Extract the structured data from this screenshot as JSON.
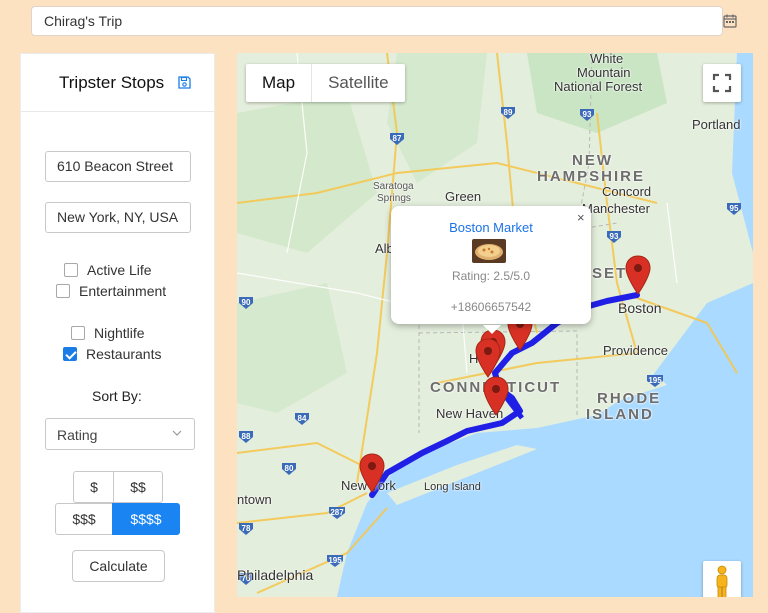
{
  "trip": {
    "name": "Chirag's Trip",
    "icon": "calendar-icon"
  },
  "sidebar": {
    "title": "Tripster Stops",
    "save_icon": "save-icon",
    "start_address": "610 Beacon Street",
    "end_address": "New York, NY, USA",
    "categories": [
      {
        "label": "Active Life",
        "checked": false
      },
      {
        "label": "Entertainment",
        "checked": false
      },
      {
        "label": "Nightlife",
        "checked": false
      },
      {
        "label": "Restaurants",
        "checked": true
      }
    ],
    "sort_label": "Sort By:",
    "sort_value": "Rating",
    "price_options": [
      "$",
      "$$",
      "$$$",
      "$$$$"
    ],
    "price_selected": "$$$$",
    "calculate_label": "Calculate"
  },
  "map": {
    "type_options": [
      "Map",
      "Satellite"
    ],
    "type_selected": "Map",
    "route_color": "#1f1fe6",
    "pin_color": "#d93025",
    "labels": {
      "white_mountain": "White",
      "white_mountain2": "Mountain",
      "white_mountain3": "National Forest",
      "portland": "Portland",
      "new": "NEW",
      "hampshire": "HAMPSHIRE",
      "concord": "Concord",
      "manchester": "Manchester",
      "saratoga": "Saratoga",
      "springs": "Springs",
      "green": "Green",
      "alb": "Alb",
      "boston": "Boston",
      "massachusetts": "SETTS",
      "providence": "Providence",
      "connecticut": "CONNECTICUT",
      "hartford": "Ha",
      "new_haven": "New Haven",
      "rhode": "RHODE",
      "island": "ISLAND",
      "new_york": "New York",
      "long_island": "Long Island",
      "philadelphia": "Philadelphia",
      "town": "ntown"
    },
    "route_shields": [
      "89",
      "87",
      "93",
      "95",
      "90",
      "91",
      "84",
      "195",
      "80",
      "78",
      "76",
      "295",
      "195",
      "95",
      "195"
    ]
  },
  "popup": {
    "name": "Boston Market",
    "rating": "Rating: 2.5/5.0",
    "phone": "+18606657542",
    "close": "×"
  }
}
